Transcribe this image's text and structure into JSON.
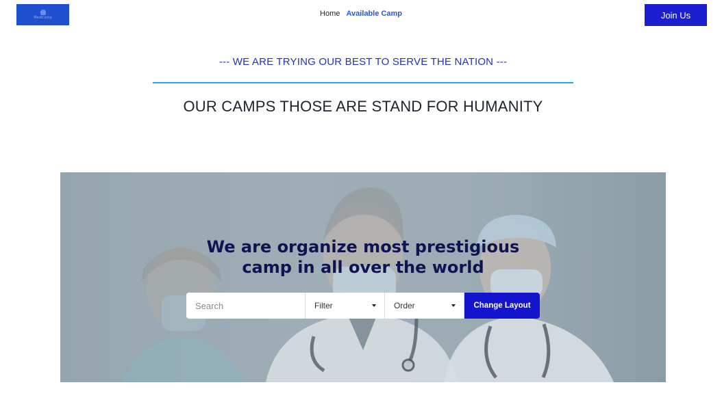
{
  "header": {
    "logo_text": "MediCamp",
    "nav": [
      {
        "label": "Home"
      },
      {
        "label": "Available Camp"
      }
    ],
    "join_label": "Join Us"
  },
  "intro": {
    "tagline": "--- WE ARE TRYING OUR BEST TO SERVE THE NATION ---",
    "heading": "OUR CAMPS THOSE ARE STAND FOR HUMANITY"
  },
  "hero": {
    "title_line1": "We are organize most prestigious",
    "title_line2": "camp in all over the world",
    "search_placeholder": "Search",
    "filter_label": "Filter",
    "order_label": "Order",
    "change_layout_label": "Change Layout"
  },
  "colors": {
    "brand": "#1c1fd0",
    "accent_line": "#27a4e3",
    "tagline": "#2432b5",
    "hero_title": "#0e1450"
  }
}
